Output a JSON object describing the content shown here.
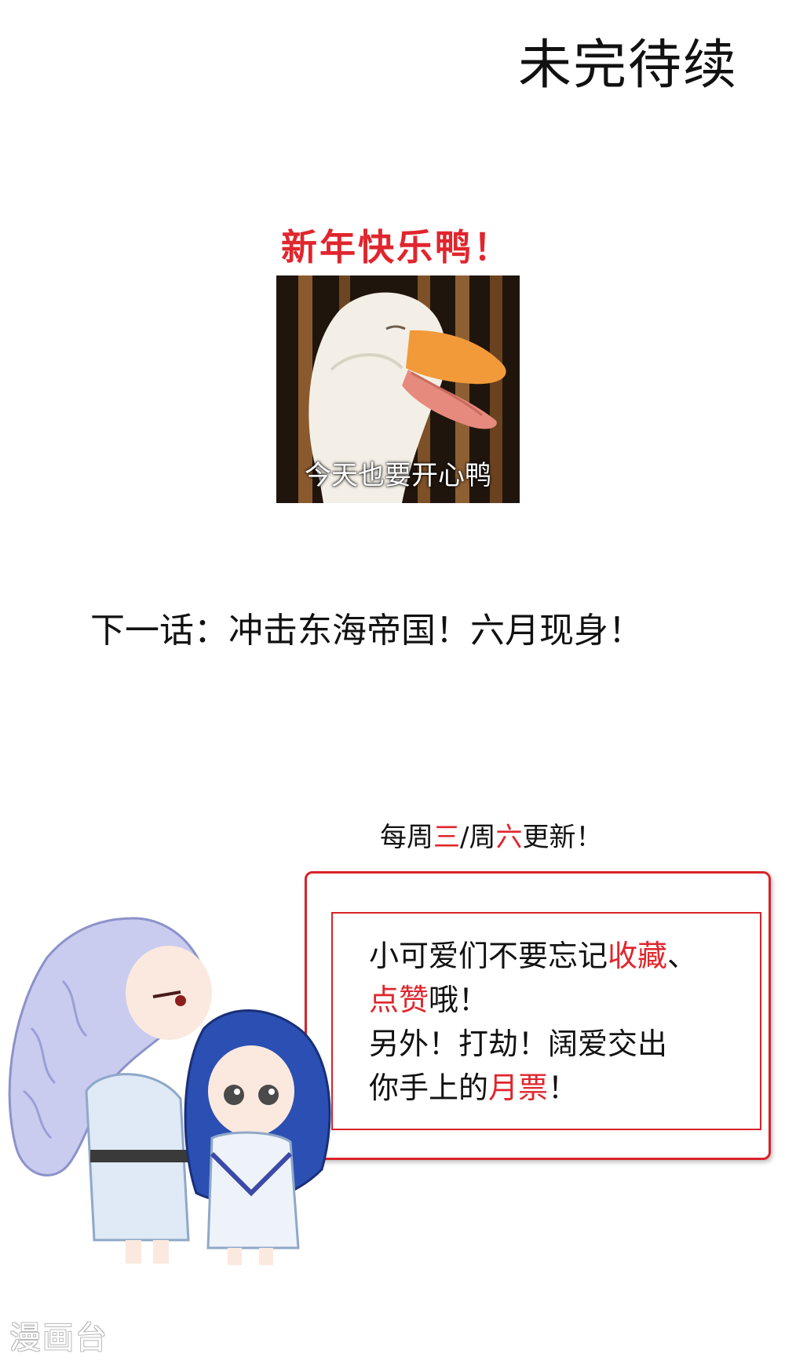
{
  "end_banner": "未完待续",
  "new_year": {
    "title": "新年快乐鸭！",
    "title_color": "#e0262d",
    "meme_caption": "今天也要开心鸭"
  },
  "next_episode": "下一话：冲击东海帝国！六月现身！",
  "schedule": {
    "prefix": "每周",
    "day1": "三",
    "sep": "/周",
    "day2": "六",
    "suffix": "更新！",
    "highlight_color": "#e0262d"
  },
  "message": {
    "line1_a": "小可爱们不要忘记",
    "line1_b": "收藏",
    "line1_c": "、",
    "line2_a": "点赞",
    "line2_b": "哦！",
    "line3": "另外！打劫！阔爱交出",
    "line4_a": "你手上的",
    "line4_b": "月票",
    "line4_c": "！",
    "border_color": "#d8232a"
  },
  "watermark": "漫画台"
}
